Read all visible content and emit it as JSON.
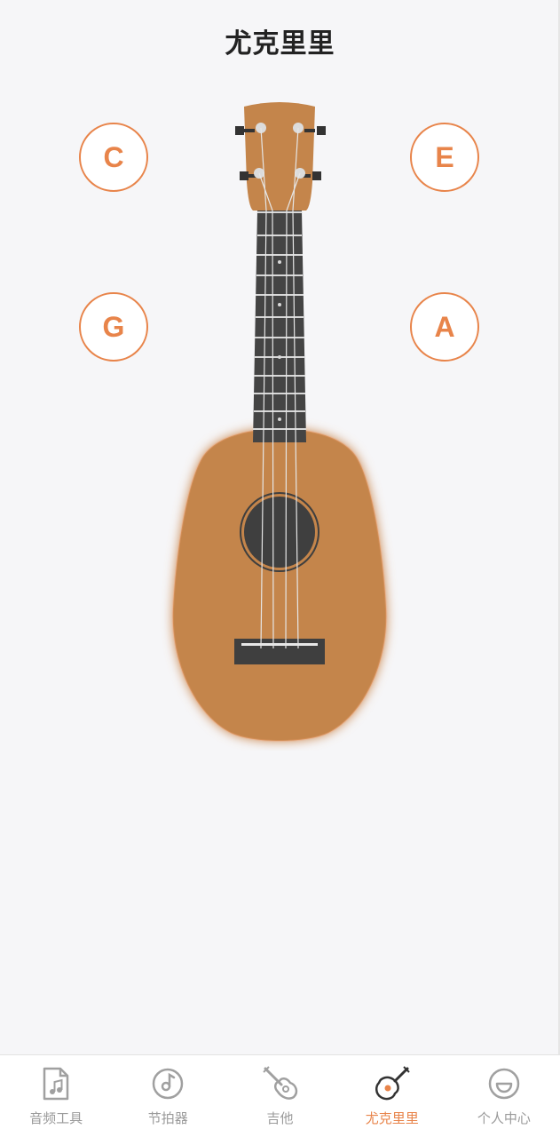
{
  "header": {
    "title": "尤克里里"
  },
  "strings": {
    "c": "C",
    "e": "E",
    "g": "G",
    "a": "A"
  },
  "colors": {
    "accent": "#e8844a",
    "body_wood": "#c4854b",
    "fretboard": "#404040",
    "inactive_tab": "#9a9a9a"
  },
  "tabbar": {
    "items": [
      {
        "label": "音频工具",
        "icon": "music-file-icon"
      },
      {
        "label": "节拍器",
        "icon": "metronome-icon"
      },
      {
        "label": "吉他",
        "icon": "guitar-icon"
      },
      {
        "label": "尤克里里",
        "icon": "ukulele-icon",
        "active": true
      },
      {
        "label": "个人中心",
        "icon": "smiley-icon"
      }
    ]
  }
}
